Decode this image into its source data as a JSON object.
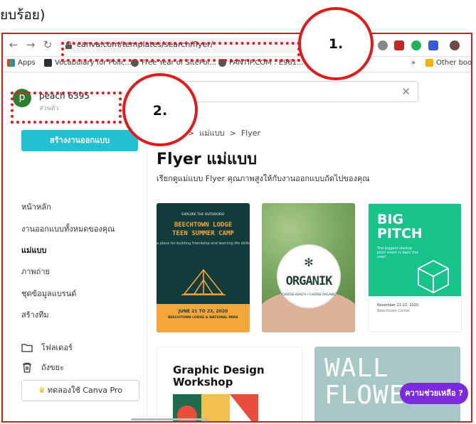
{
  "caption": "ยบร้อย)",
  "browser": {
    "url": "canva.com/templates/search/flyer/",
    "bookmarks": [
      {
        "label": "Apps"
      },
      {
        "label": "Vocabulary for Polic..."
      },
      {
        "label": "Free Year of SitePoi..."
      },
      {
        "label": "PANTIP.COM : E961..."
      },
      {
        "label": "Other bookmar"
      }
    ],
    "more_label": "»"
  },
  "sidebar": {
    "avatar_letter": "p",
    "user_name": "peach 6395",
    "user_sub": "ส่วนตัว",
    "create_label": "สร้างงานออกแบบ",
    "items": [
      {
        "label": "หน้าหลัก"
      },
      {
        "label": "งานออกแบบทั้งหมดของคุณ"
      },
      {
        "label": "แม่แบบ"
      },
      {
        "label": "ภาพถ่าย"
      },
      {
        "label": "ชุดข้อมูลแบรนด์"
      },
      {
        "label": "สร้างทีม"
      }
    ],
    "folder_label": "โฟลเดอร์",
    "trash_label": "ถังขยะ",
    "pro_label": "ทดลองใช้ Canva Pro"
  },
  "main": {
    "breadcrumb_sep": ">",
    "breadcrumb_current": "แม่แบบ",
    "breadcrumb_last": "Flyer",
    "title": "Flyer แม่แบบ",
    "subtitle": "เรียกดูแม่แบบ Flyer คุณภาพสูงให้กับงานออกแบบถัดไปของคุณ",
    "cards": {
      "beechtown": {
        "kicker": "EXPLORE THE OUTDOORS!",
        "line1": "BEECHTOWN LODGE",
        "line2": "TEEN SUMMER CAMP",
        "tag": "a place for building friendship and learning life skills",
        "date": "JUNE 21 TO 23, 2020",
        "place": "BEECHTOWN LODGE & NATIONAL PARK"
      },
      "organik": {
        "logo": "ORGANIK",
        "tag": "CHOOSE HEALTH • CHOOSE ORGANIC",
        "sprig": "✻"
      },
      "pitch": {
        "line1": "BIG",
        "line2": "PITCH",
        "caption": "The biggest startup pitch event is back this year!",
        "date": "November 21-22, 2020",
        "venue": "Beechtown Center"
      },
      "graphic": {
        "line1": "Graphic Design",
        "line2": "Workshop"
      },
      "wall": {
        "line1": "WALL",
        "line2": "FLOWER"
      }
    },
    "help_label": "ความช่วยเหลือ ?"
  },
  "annotations": {
    "one": "1.",
    "two": "2."
  },
  "colors": {
    "accent": "#21c0d3",
    "annotation": "#e11b1b",
    "help": "#7b2bdd"
  }
}
